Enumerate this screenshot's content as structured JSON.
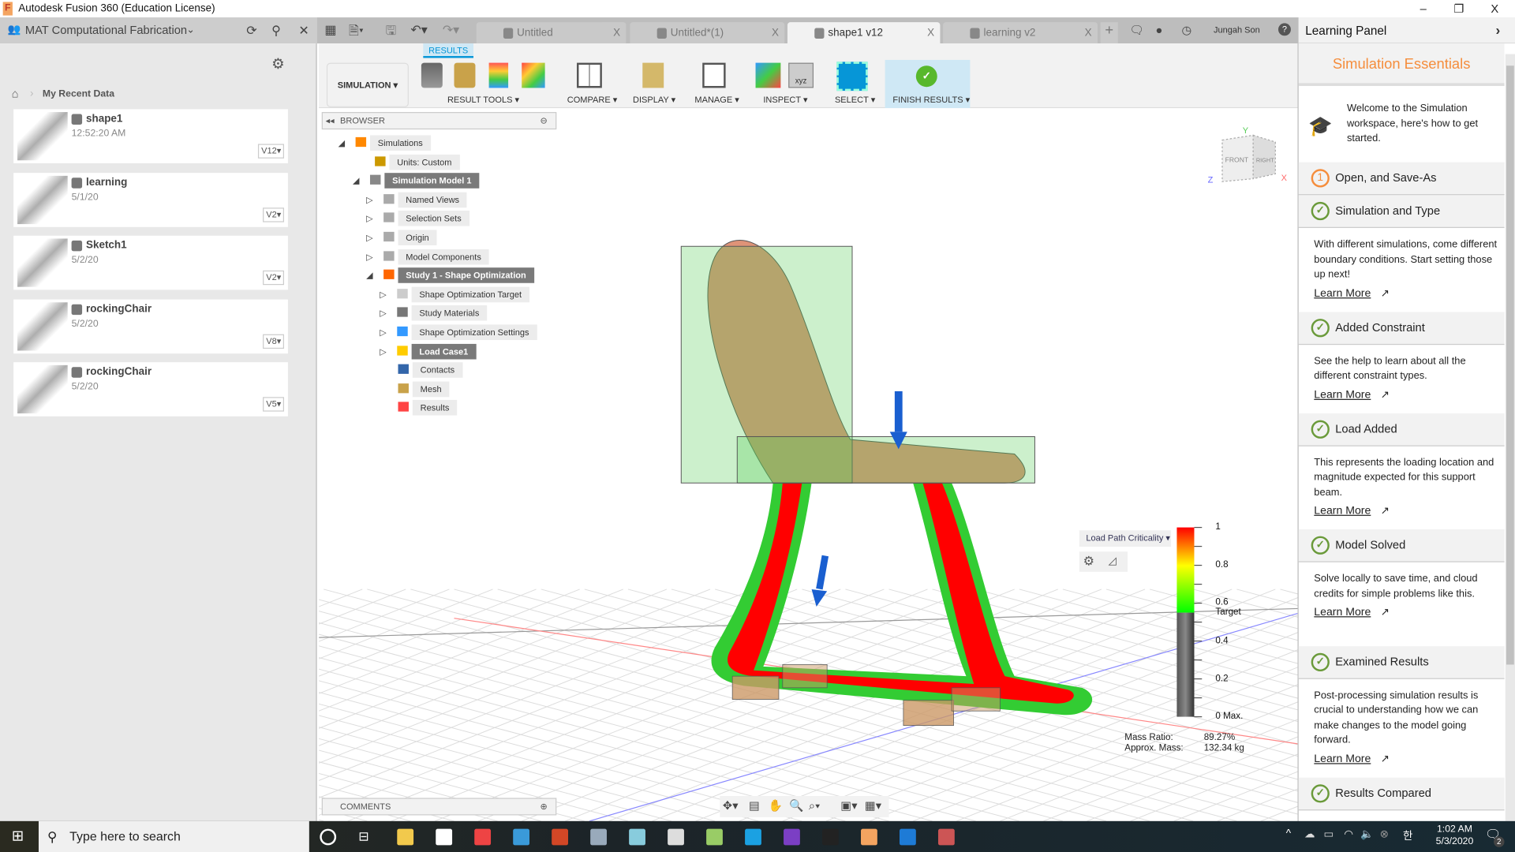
{
  "window": {
    "title": "Autodesk Fusion 360 (Education License)",
    "controls": [
      "–",
      "❐",
      "X"
    ]
  },
  "data_panel": {
    "project": "MAT Computational Fabrication",
    "breadcrumb": "My Recent Data",
    "items": [
      {
        "name": "shape1",
        "date": "12:52:20 AM",
        "version": "V12"
      },
      {
        "name": "learning",
        "date": "5/1/20",
        "version": "V2"
      },
      {
        "name": "Sketch1",
        "date": "5/2/20",
        "version": "V2"
      },
      {
        "name": "rockingChair",
        "date": "5/2/20",
        "version": "V8"
      },
      {
        "name": "rockingChair",
        "date": "5/2/20",
        "version": "V5"
      }
    ]
  },
  "tabs": [
    {
      "label": "Untitled",
      "active": false
    },
    {
      "label": "Untitled*(1)",
      "active": false
    },
    {
      "label": "shape1 v12",
      "active": true
    },
    {
      "label": "learning v2",
      "active": false
    }
  ],
  "user": "Jungah Son",
  "toolbar": {
    "workspace": "SIMULATION",
    "active_tab": "RESULTS",
    "groups": [
      "RESULT TOOLS",
      "COMPARE",
      "DISPLAY",
      "MANAGE",
      "INSPECT",
      "SELECT",
      "FINISH RESULTS"
    ]
  },
  "browser": {
    "title": "BROWSER",
    "rows": [
      "Simulations",
      "Units: Custom",
      "Simulation Model 1",
      "Named Views",
      "Selection Sets",
      "Origin",
      "Model Components",
      "Study 1 - Shape Optimization",
      "Shape Optimization Target",
      "Study Materials",
      "Shape Optimization Settings",
      "Load Case1",
      "Contacts",
      "Mesh",
      "Results"
    ]
  },
  "comments": "COMMENTS",
  "viewcube": {
    "front": "FRONT",
    "right": "RIGHT",
    "x": "X",
    "y": "Y",
    "z": "Z"
  },
  "legend": {
    "dropdown": "Load Path Criticality",
    "ticks": [
      "1",
      "0.8",
      "0.6",
      "Target",
      "0.4",
      "0.2",
      "0 Max."
    ],
    "target_value": 0.55,
    "mass_ratio_label": "Mass Ratio:",
    "mass_ratio": "89.27%",
    "approx_mass_label": "Approx. Mass:",
    "approx_mass": "132.34 kg"
  },
  "learning": {
    "title": "Learning Panel",
    "heading": "Simulation Essentials",
    "intro": "Welcome to the Simulation workspace, here's how to get started.",
    "learn_more": "Learn More",
    "steps": [
      {
        "title": "Open, and Save-As",
        "status": "1",
        "body": ""
      },
      {
        "title": "Simulation and Type",
        "status": "done",
        "body": "With different simulations, come different boundary conditions. Start setting those up next!"
      },
      {
        "title": "Added Constraint",
        "status": "done",
        "body": "See the help to learn about all the different constraint types."
      },
      {
        "title": "Load Added",
        "status": "done",
        "body": "This represents the loading location and magnitude expected for this support beam."
      },
      {
        "title": "Model Solved",
        "status": "done",
        "body": "Solve locally to save time, and cloud credits for simple problems like this."
      },
      {
        "title": "Examined Results",
        "status": "done",
        "body": "Post-processing simulation results is crucial to understanding how we can make changes to the model going forward."
      },
      {
        "title": "Results Compared",
        "status": "done",
        "body": ""
      }
    ]
  },
  "taskbar": {
    "search_placeholder": "Type here to search",
    "time": "1:02 AM",
    "date": "5/3/2020",
    "notifications": "2",
    "ime": "한"
  },
  "colors": {
    "accent": "#0696d7",
    "orange": "#f58d3c",
    "check": "#6a9a3a",
    "stress_high": "#ff0000",
    "stress_mid": "#ffff00",
    "stress_low": "#00ff00"
  }
}
